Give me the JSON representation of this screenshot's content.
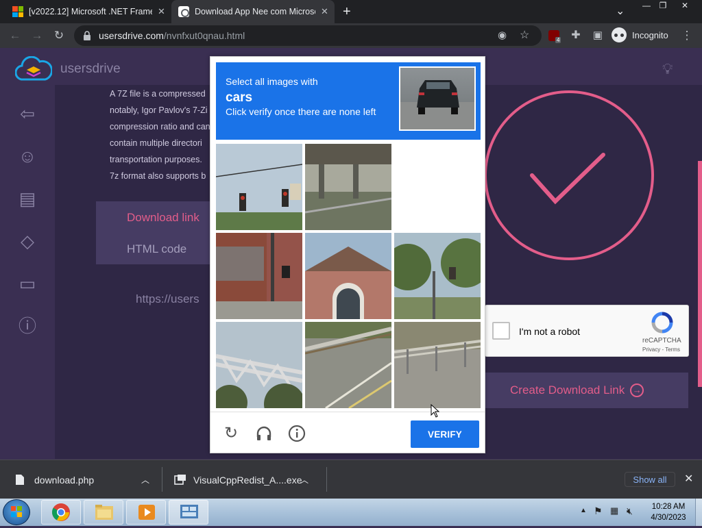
{
  "browser": {
    "tabs": [
      {
        "title": "[v2022.12] Microsoft .NET Framew",
        "close": "✕"
      },
      {
        "title": "Download App Nee com Microsof",
        "close": "✕"
      }
    ],
    "new_tab": "+",
    "tab_menu": "⌄",
    "window_controls": [
      "—",
      "❐",
      "✕"
    ],
    "url_host": "usersdrive.com",
    "url_path": "/nvnfxut0qnau.html",
    "extension_badge": "4",
    "profile_label": "Incognito"
  },
  "site": {
    "logo_text": "usersdrive",
    "paragraph_lines": [
      "A 7Z file is a compressed",
      "notably, Igor Pavlov's 7-Zi",
      "compression ratio and can",
      "contain multiple directori",
      "transportation purposes.",
      "7z format also supports b"
    ],
    "tab_download": "Download link",
    "tab_html": "HTML code",
    "url_preview": "https://users",
    "create_link_label": "Create Download Link",
    "create_link_icon": "→"
  },
  "recaptcha": {
    "checkbox_label": "I'm not a robot",
    "brand": "reCAPTCHA",
    "terms": "Privacy - Terms"
  },
  "challenge": {
    "line1": "Select all images with",
    "target": "cars",
    "line3": "Click verify once there are none left",
    "verify_label": "VERIFY",
    "tiles": [
      "traffic-lights",
      "overpass",
      "empty",
      "brick-building-pole",
      "brick-house",
      "trees-traffic-light",
      "bridge-trusses",
      "road-guardrail",
      "road-railing"
    ]
  },
  "downloads": {
    "items": [
      {
        "name": "download.php"
      },
      {
        "name": "VisualCppRedist_A....exe"
      }
    ],
    "show_all": "Show all",
    "close": "✕"
  },
  "taskbar": {
    "time": "10:28 AM",
    "date": "4/30/2023"
  }
}
